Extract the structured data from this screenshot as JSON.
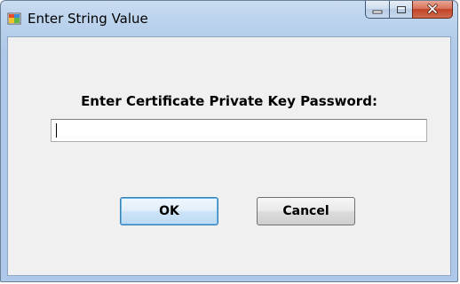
{
  "window": {
    "title": "Enter String Value",
    "app_icon": "window-app-icon",
    "caption_buttons": {
      "minimize_icon": "minimize-icon",
      "maximize_icon": "maximize-icon",
      "close_icon": "close-icon"
    }
  },
  "dialog": {
    "prompt": "Enter Certificate Private Key Password:",
    "password": {
      "value": "",
      "placeholder": ""
    },
    "ok_label": "OK",
    "cancel_label": "Cancel"
  },
  "colors": {
    "title_bar": "#c2d8ef",
    "client_bg": "#f0f0f0",
    "close_button": "#c24228",
    "default_button_border": "#3c7fb1"
  }
}
